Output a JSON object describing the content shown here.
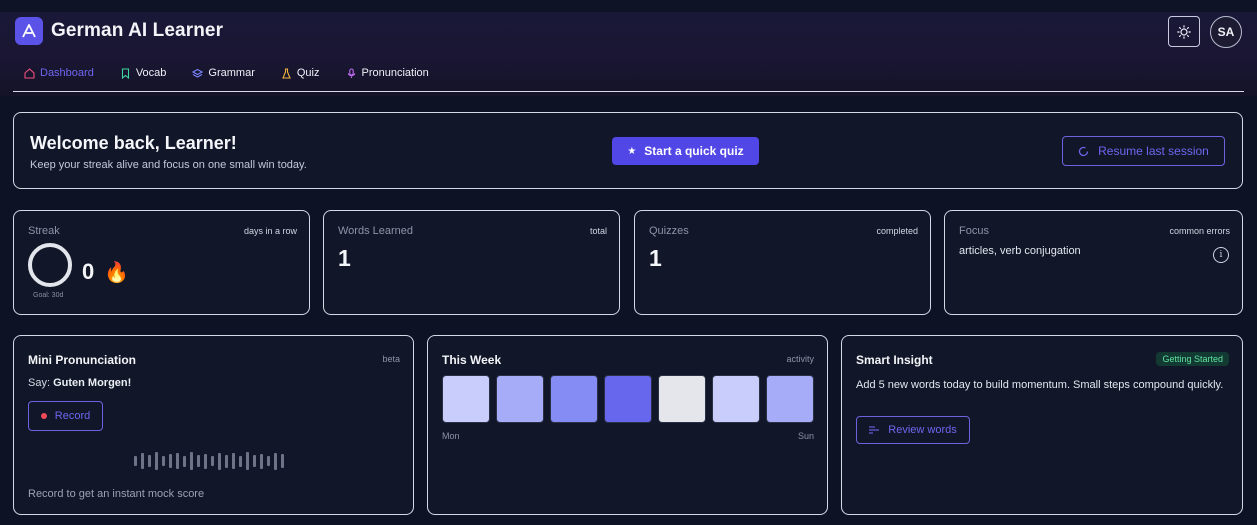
{
  "app": {
    "title": "German AI Learner",
    "avatar_initials": "SA"
  },
  "nav": [
    {
      "label": "Dashboard",
      "icon": "home-icon",
      "active": true
    },
    {
      "label": "Vocab",
      "icon": "bookmark-icon",
      "active": false
    },
    {
      "label": "Grammar",
      "icon": "layers-icon",
      "active": false
    },
    {
      "label": "Quiz",
      "icon": "flask-icon",
      "active": false
    },
    {
      "label": "Pronunciation",
      "icon": "microphone-icon",
      "active": false
    }
  ],
  "welcome": {
    "title": "Welcome back, Learner!",
    "subtitle": "Keep your streak alive and focus on one small win today.",
    "quiz_button": "Start a quick quiz",
    "resume_button": "Resume last session"
  },
  "stats": {
    "streak": {
      "label": "Streak",
      "meta": "days in a row",
      "value": "0",
      "goal": "Goal: 30d",
      "progress": 0
    },
    "words": {
      "label": "Words Learned",
      "meta": "total",
      "value": "1"
    },
    "quizzes": {
      "label": "Quizzes",
      "meta": "completed",
      "value": "1"
    },
    "focus": {
      "label": "Focus",
      "meta": "common errors",
      "value": "articles, verb conjugation"
    }
  },
  "pronunciation": {
    "title": "Mini Pronunciation",
    "meta": "beta",
    "say_prefix": "Say:",
    "phrase": "Guten Morgen!",
    "record_button": "Record",
    "hint": "Record to get an instant mock score"
  },
  "week": {
    "title": "This Week",
    "meta": "activity",
    "start_label": "Mon",
    "end_label": "Sun",
    "days": [
      {
        "color": "#c9cdfb"
      },
      {
        "color": "#a6acf8"
      },
      {
        "color": "#858cf3"
      },
      {
        "color": "#6767ee"
      },
      {
        "color": "#e4e6ec"
      },
      {
        "color": "#c9cdfb"
      },
      {
        "color": "#a6acf8"
      }
    ]
  },
  "insight": {
    "title": "Smart Insight",
    "badge": "Getting Started",
    "text": "Add 5 new words today to build momentum. Small steps compound quickly.",
    "review_button": "Review words"
  },
  "colors": {
    "accent": "#5146e6",
    "accent_text": "#6f66f0",
    "background": "#0d1224"
  }
}
